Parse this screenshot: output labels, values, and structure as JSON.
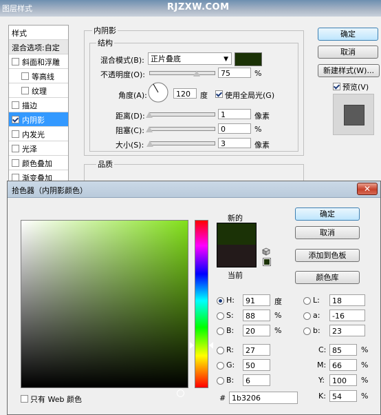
{
  "background": {
    "title": "图层样式",
    "watermark": "RJZXW.COM",
    "sidebar": [
      {
        "label": "样式",
        "checkbox": false
      },
      {
        "label": "混合选项:自定",
        "checkbox": false
      },
      {
        "label": "斜面和浮雕",
        "checkbox": true,
        "checked": false
      },
      {
        "label": "等高线",
        "checkbox": true,
        "checked": false,
        "indent": true
      },
      {
        "label": "纹理",
        "checkbox": true,
        "checked": false,
        "indent": true
      },
      {
        "label": "描边",
        "checkbox": true,
        "checked": false
      },
      {
        "label": "内阴影",
        "checkbox": true,
        "checked": true,
        "selected": true
      },
      {
        "label": "内发光",
        "checkbox": true,
        "checked": false
      },
      {
        "label": "光泽",
        "checkbox": true,
        "checked": false
      },
      {
        "label": "颜色叠加",
        "checkbox": true,
        "checked": false
      },
      {
        "label": "渐变叠加",
        "checkbox": true,
        "checked": false
      }
    ],
    "inner_shadow": {
      "section_title": "内阴影",
      "structure_title": "结构",
      "blend_mode_label": "混合模式(B):",
      "blend_mode_value": "正片叠底",
      "shadow_color": "#1b3206",
      "opacity_label": "不透明度(O):",
      "opacity_value": "75",
      "opacity_unit": "%",
      "angle_label": "角度(A):",
      "angle_value": "120",
      "angle_unit": "度",
      "global_light_label": "使用全局光(G)",
      "global_light_checked": true,
      "distance_label": "距离(D):",
      "distance_value": "1",
      "distance_unit": "像素",
      "choke_label": "阻塞(C):",
      "choke_value": "0",
      "choke_unit": "%",
      "size_label": "大小(S):",
      "size_value": "3",
      "size_unit": "像素",
      "quality_title": "品质"
    },
    "buttons": {
      "ok": "确定",
      "cancel": "取消",
      "new_style": "新建样式(W)...",
      "preview_label": "预览(V)",
      "preview_checked": true
    }
  },
  "picker": {
    "title": "拾色器（内阴影颜色）",
    "new_label": "新的",
    "current_label": "当前",
    "new_color": "#1b3206",
    "current_color": "#231a1a",
    "buttons": {
      "ok": "确定",
      "cancel": "取消",
      "add_swatch": "添加到色板",
      "color_library": "颜色库"
    },
    "hsb": {
      "h_label": "H:",
      "h_value": "91",
      "h_unit": "度",
      "s_label": "S:",
      "s_value": "88",
      "s_unit": "%",
      "b_label": "B:",
      "b_value": "20",
      "b_unit": "%"
    },
    "rgb": {
      "r_label": "R:",
      "r_value": "27",
      "g_label": "G:",
      "g_value": "50",
      "b_label": "B:",
      "b_value": "6"
    },
    "lab": {
      "l_label": "L:",
      "l_value": "18",
      "a_label": "a:",
      "a_value": "-16",
      "b_label": "b:",
      "b_value": "23"
    },
    "cmyk": {
      "c_label": "C:",
      "c_value": "85",
      "c_unit": "%",
      "m_label": "M:",
      "m_value": "66",
      "m_unit": "%",
      "y_label": "Y:",
      "y_value": "100",
      "y_unit": "%",
      "k_label": "K:",
      "k_value": "54",
      "k_unit": "%"
    },
    "hex_label": "#",
    "hex_value": "1b3206",
    "web_only_label": "只有 Web 颜色",
    "web_only_checked": false,
    "selected_mode": "H",
    "hue_color": "#82e01a"
  }
}
